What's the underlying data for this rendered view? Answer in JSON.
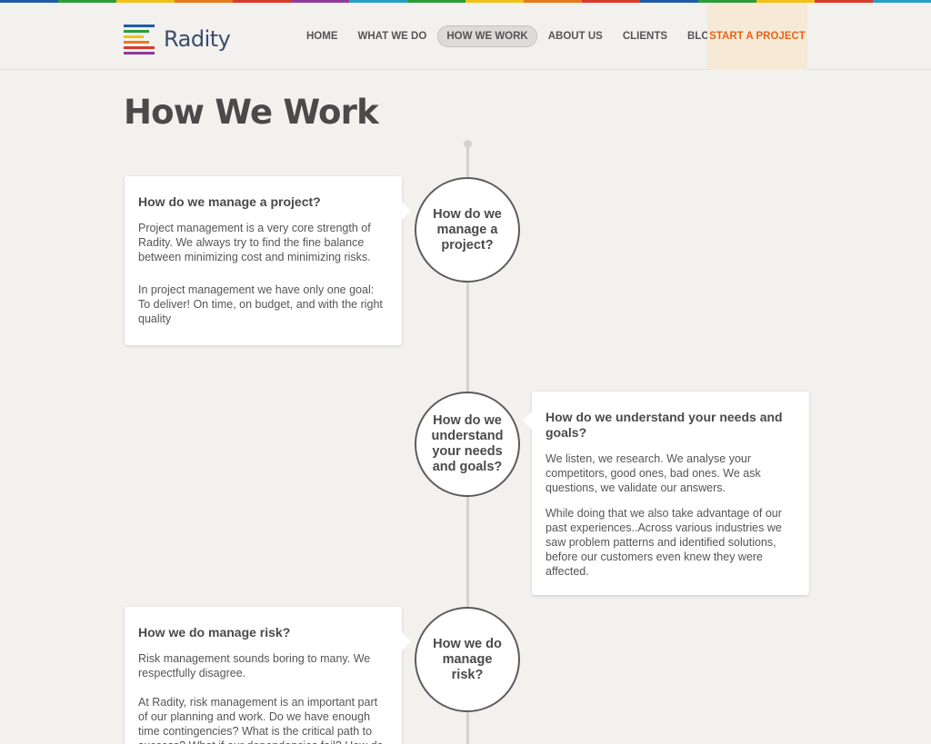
{
  "brand": {
    "name": "Radity",
    "stripe_colors": [
      "#1f5aa8",
      "#2a9d3a",
      "#f2c01a",
      "#e8781e",
      "#d63a2a",
      "#8e3b9c",
      "#24a0c8"
    ]
  },
  "nav": {
    "items": [
      {
        "label": "HOME"
      },
      {
        "label": "WHAT WE DO"
      },
      {
        "label": "HOW WE WORK",
        "active": true
      },
      {
        "label": "ABOUT US"
      },
      {
        "label": "CLIENTS"
      },
      {
        "label": "BLOG"
      }
    ],
    "cta": "START A PROJECT"
  },
  "page": {
    "title": "How We Work"
  },
  "sections": [
    {
      "circle": "How do we manage a project?",
      "heading": "How do we manage a project?",
      "paragraphs": [
        "Project management is a very core strength of Radity. We always try to find the fine balance between minimizing cost and minimizing risks.",
        "In project management we have only one goal: To deliver! On time, on budget, and with the right quality"
      ]
    },
    {
      "circle": "How do we understand your needs and goals?",
      "heading": "How do we understand your needs and goals?",
      "paragraphs": [
        "We listen, we research. We analyse your competitors, good ones, bad ones. We ask questions, we validate our answers.",
        "While doing that we also take advantage of our past experiences..Across various industries we saw problem patterns and identified solutions, before our customers even knew they were affected."
      ]
    },
    {
      "circle": "How we do manage risk?",
      "heading": "How we do manage risk?",
      "paragraphs": [
        "Risk management sounds boring to many. We respectfully disagree.",
        "At Radity, risk management is an important part of our planning and work. Do we have enough time contingencies? What is the critical path to success? What if our dependencies fail? How do"
      ]
    }
  ]
}
